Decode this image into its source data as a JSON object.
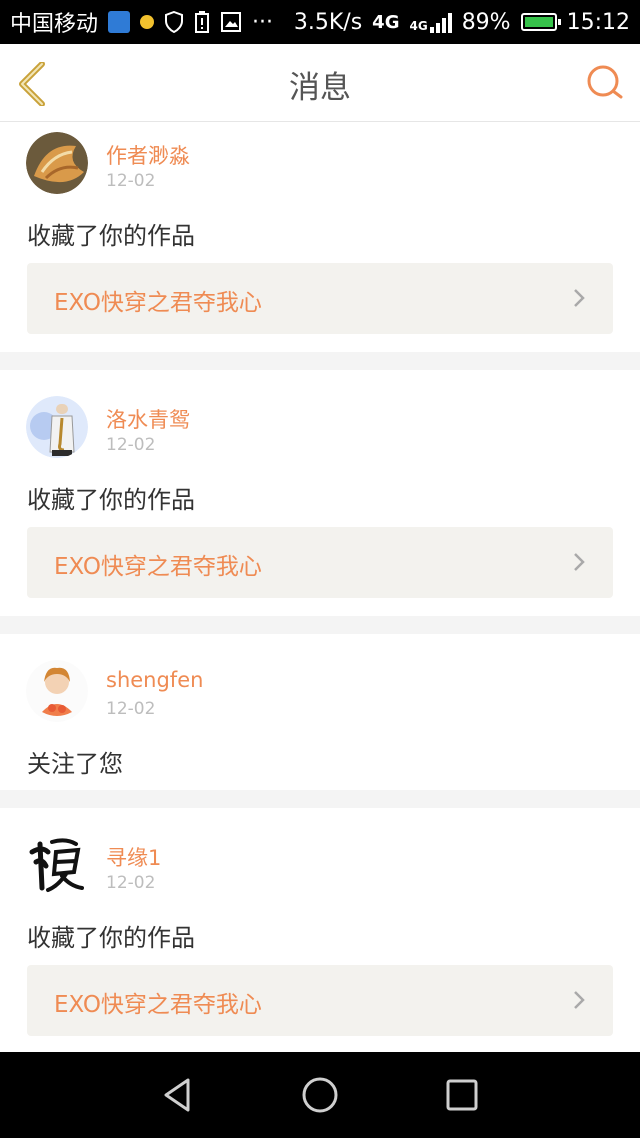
{
  "status_bar": {
    "carrier": "中国移动",
    "more": "···",
    "speed": "3.5K/s",
    "network_main": "4G",
    "network_sub": "4G",
    "battery_percent": "89%",
    "battery_level": 0.89,
    "time": "15:12",
    "icons": [
      "wifi-hotspot-icon",
      "notification-dot-icon",
      "shield-icon",
      "battery-alert-icon",
      "image-icon",
      "signal-icon",
      "battery-icon"
    ]
  },
  "header": {
    "title": "消息",
    "back_icon": "chevron-left-icon",
    "search_icon": "search-icon",
    "accent": "#ef8b53"
  },
  "messages": [
    {
      "username": "作者渺淼",
      "date": "12-02",
      "action": "收藏了你的作品",
      "work_title": "EXO快穿之君夺我心"
    },
    {
      "username": "洛水青鸳",
      "date": "12-02",
      "action": "收藏了你的作品",
      "work_title": "EXO快穿之君夺我心"
    },
    {
      "username": "shengfen",
      "date": "12-02",
      "action": "关注了您"
    },
    {
      "username": "寻缘1",
      "date": "12-02",
      "action": "收藏了你的作品",
      "work_title": "EXO快穿之君夺我心"
    }
  ],
  "nav_bar": {
    "icons": [
      "back-triangle-icon",
      "home-circle-icon",
      "recents-square-icon"
    ]
  }
}
